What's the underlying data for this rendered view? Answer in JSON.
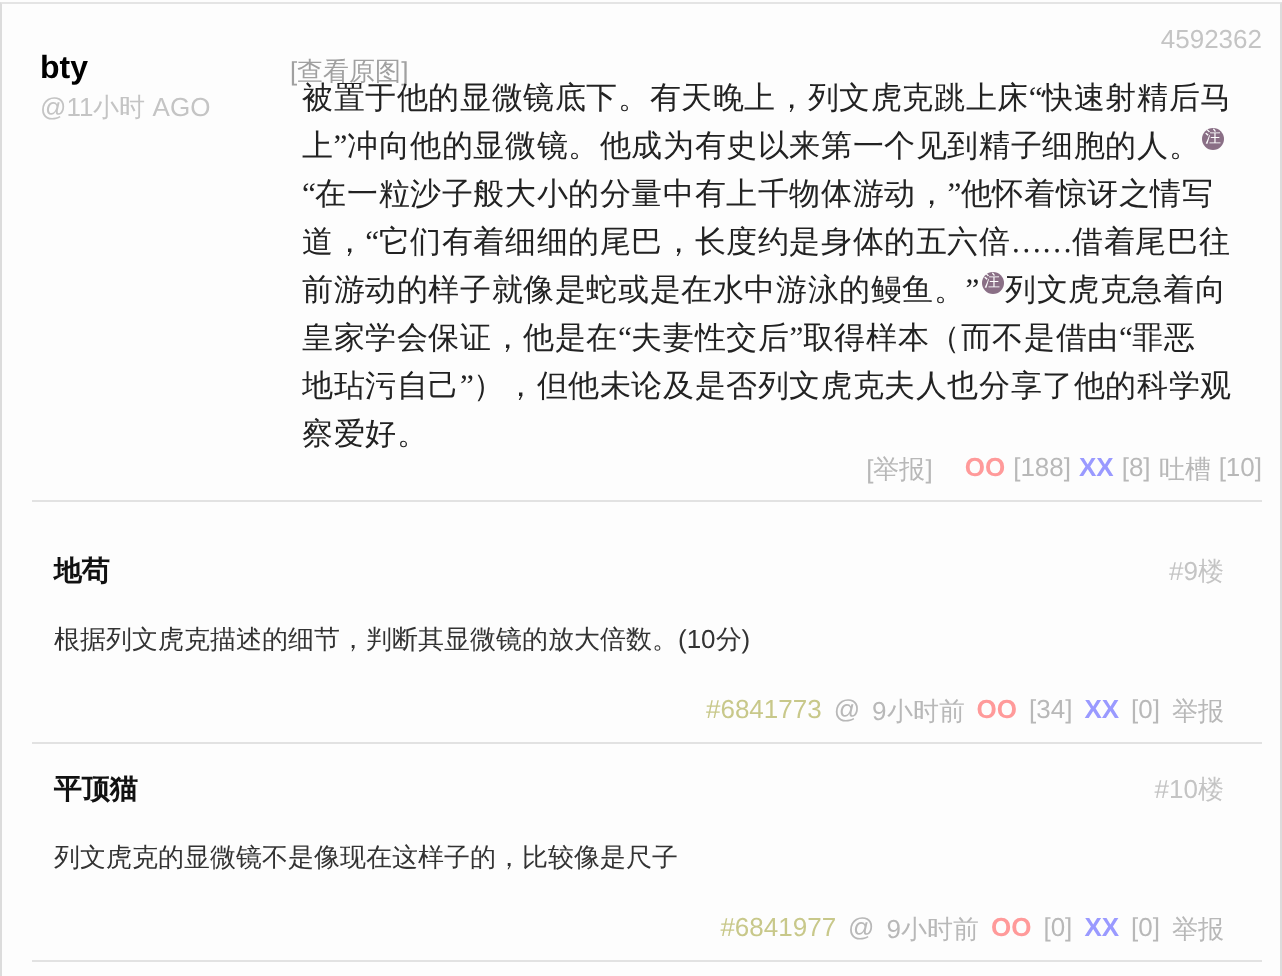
{
  "post": {
    "author": "bty",
    "time": "@11小时 AGO",
    "id": "4592362",
    "view_original": "[查看原图]",
    "lines": [
      [
        {
          "kind": "text",
          "text": "被置于他的显微镜底下。有天晚上，列文虎克跳上床“快速射精后马"
        }
      ],
      [
        {
          "kind": "text",
          "text": "上”冲向他的显微镜。他成为有史以来第一个见到精子细胞的人。"
        },
        {
          "kind": "note",
          "text": "注"
        }
      ],
      [
        {
          "kind": "text",
          "text": "“在一粒沙子般大小的分量中有上千物体游动，”他怀着惊讶之情写"
        }
      ],
      [
        {
          "kind": "text",
          "text": "道，“它们有着细细的尾巴，长度约是身体的五六倍……借着尾巴往"
        }
      ],
      [
        {
          "kind": "text",
          "text": "前游动的样子就像是蛇或是在水中游泳的鳗鱼。”"
        },
        {
          "kind": "note",
          "text": "注"
        },
        {
          "kind": "text",
          "text": "列文虎克急着向"
        }
      ],
      [
        {
          "kind": "text",
          "text": "皇家学会保证，他是在“夫妻性交后”取得样本（而不是借由“罪恶"
        }
      ],
      [
        {
          "kind": "text",
          "text": "地玷污自己”），但他未论及是否列文虎克夫人也分享了他的科学观"
        }
      ],
      [
        {
          "kind": "text",
          "text": "察爱好。"
        }
      ]
    ],
    "footer": {
      "report": "[举报]",
      "oo": "OO",
      "oo_count": "[188]",
      "xx": "XX",
      "xx_count": "[8]",
      "tucao": "吐槽",
      "tucao_count": "[10]"
    }
  },
  "comments": [
    {
      "author": "地苟",
      "floor": "#9楼",
      "body": "根据列文虎克描述的细节，判断其显微镜的放大倍数。(10分)",
      "id": "#6841773",
      "at": "@",
      "time": "9小时前",
      "oo": "OO",
      "oo_count": "[34]",
      "xx": "XX",
      "xx_count": "[0]",
      "report": "举报"
    },
    {
      "author": "平顶猫",
      "floor": "#10楼",
      "body": "列文虎克的显微镜不是像现在这样子的，比较像是尺子",
      "id": "#6841977",
      "at": "@",
      "time": "9小时前",
      "oo": "OO",
      "oo_count": "[0]",
      "xx": "XX",
      "xx_count": "[0]",
      "report": "举报"
    }
  ]
}
